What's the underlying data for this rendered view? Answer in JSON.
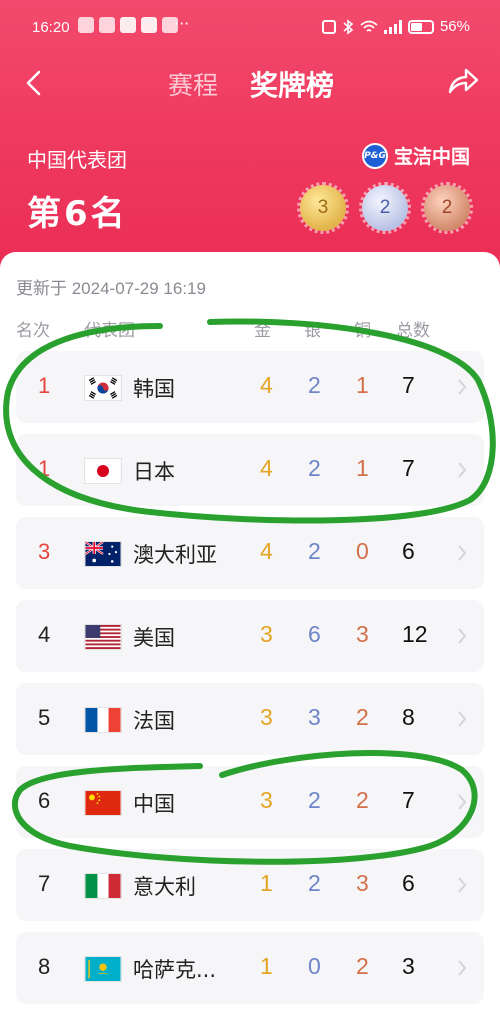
{
  "status": {
    "time": "16:20",
    "more": "···",
    "battery": "56%"
  },
  "nav": {
    "tab_schedule": "赛程",
    "tab_medals": "奖牌榜"
  },
  "team": {
    "label": "中国代表团",
    "rank": "第6名",
    "sponsor": "宝洁中国",
    "sponsor_badge": "P&G",
    "medals": {
      "gold": "3",
      "silver": "2",
      "bronze": "2"
    }
  },
  "table": {
    "updated": "更新于 2024-07-29 16:19",
    "headers": {
      "rank": "名次",
      "team": "代表团",
      "gold": "金",
      "silver": "银",
      "bronze": "铜",
      "total": "总数"
    },
    "rows": [
      {
        "rank": "1",
        "country": "韩国",
        "gold": "4",
        "silver": "2",
        "bronze": "1",
        "total": "7",
        "flag": "korea"
      },
      {
        "rank": "1",
        "country": "日本",
        "gold": "4",
        "silver": "2",
        "bronze": "1",
        "total": "7",
        "flag": "japan"
      },
      {
        "rank": "3",
        "country": "澳大利亚",
        "gold": "4",
        "silver": "2",
        "bronze": "0",
        "total": "6",
        "flag": "australia"
      },
      {
        "rank": "4",
        "country": "美国",
        "gold": "3",
        "silver": "6",
        "bronze": "3",
        "total": "12",
        "flag": "usa"
      },
      {
        "rank": "5",
        "country": "法国",
        "gold": "3",
        "silver": "3",
        "bronze": "2",
        "total": "8",
        "flag": "france"
      },
      {
        "rank": "6",
        "country": "中国",
        "gold": "3",
        "silver": "2",
        "bronze": "2",
        "total": "7",
        "flag": "china"
      },
      {
        "rank": "7",
        "country": "意大利",
        "gold": "1",
        "silver": "2",
        "bronze": "3",
        "total": "6",
        "flag": "italy"
      },
      {
        "rank": "8",
        "country": "哈萨克...",
        "gold": "1",
        "silver": "0",
        "bronze": "2",
        "total": "3",
        "flag": "kazakhstan"
      }
    ]
  },
  "colors": {
    "hero": "#ef3a5f",
    "gold": "#e3a524",
    "silver": "#6e86c9",
    "bronze": "#d2704a",
    "annotation": "#2aa12e"
  }
}
